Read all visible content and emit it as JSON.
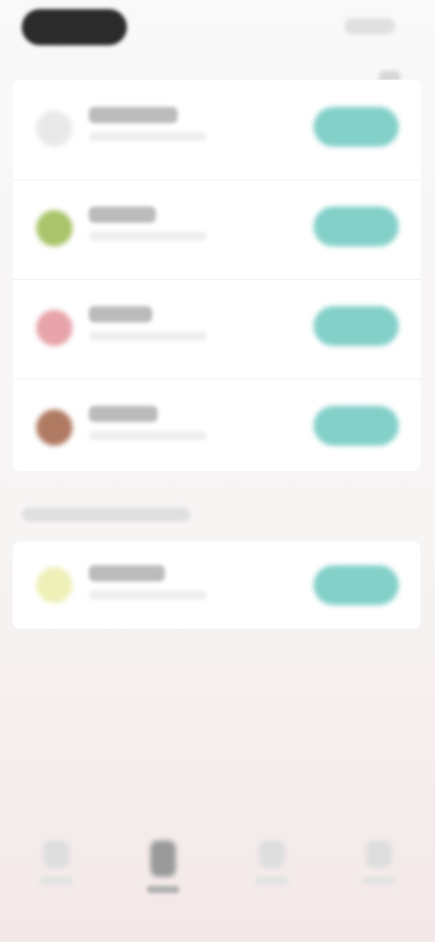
{
  "header": {
    "title": "",
    "action_label": ""
  },
  "colors": {
    "accent": "#83d0c9",
    "header_pill": "#2b2b2b",
    "background_bottom": "#f3e8e8"
  },
  "icons": {
    "top_right": "info-icon"
  },
  "list_main": {
    "items": [
      {
        "title": "",
        "subtitle": "",
        "button_label": "",
        "icon_color": "#e9e9e9"
      },
      {
        "title": "",
        "subtitle": "",
        "button_label": "",
        "icon_color": "#a9c46a"
      },
      {
        "title": "",
        "subtitle": "",
        "button_label": "",
        "icon_color": "#e7a4aa"
      },
      {
        "title": "",
        "subtitle": "",
        "button_label": "",
        "icon_color": "#b07a62"
      }
    ]
  },
  "section": {
    "label": ""
  },
  "list_secondary": {
    "items": [
      {
        "title": "",
        "subtitle": "",
        "button_label": "",
        "icon_color": "#eef0b8"
      }
    ]
  },
  "bottom_nav": {
    "items": [
      {
        "label": "",
        "icon": "home-icon",
        "active": false
      },
      {
        "label": "",
        "icon": "list-icon",
        "active": true
      },
      {
        "label": "",
        "icon": "chat-icon",
        "active": false
      },
      {
        "label": "",
        "icon": "profile-icon",
        "active": false
      }
    ]
  }
}
